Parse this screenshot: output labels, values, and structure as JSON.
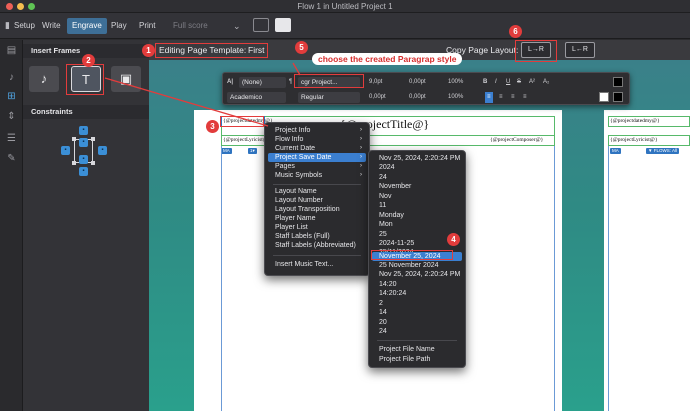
{
  "window": {
    "title": "Flow 1 in Untitled Project 1",
    "traffic_colors": [
      "#ee5f57",
      "#f5bd4f",
      "#5fc454"
    ]
  },
  "toolbar": {
    "modes": [
      "Setup",
      "Write",
      "Engrave",
      "Play",
      "Print"
    ],
    "active_mode": "Engrave",
    "score_selector": "Full score",
    "dropdown_arrow": "⌄"
  },
  "panel": {
    "insert_frames_heading": "Insert Frames",
    "frame_buttons": [
      {
        "icon": "music-frame-icon",
        "glyph": "♪"
      },
      {
        "icon": "text-frame-icon",
        "glyph": "T"
      },
      {
        "icon": "graphics-frame-icon",
        "glyph": "▣"
      }
    ],
    "constraints_heading": "Constraints",
    "lock_glyph": "🔒"
  },
  "workspace": {
    "editing_template_label": "Editing Page Template:",
    "editing_template_value": "First",
    "copy_layout_label": "Copy Page Layout:",
    "copy_forward": "L→R",
    "copy_back": "L←R"
  },
  "para_popover": {
    "style_none": "(None)",
    "para_style": "cgr Project...",
    "font_name": "Academico",
    "font_weight": "Regular",
    "font_size": "9,0pt",
    "spacing1": "0,00pt",
    "spacing2": "0,00pt",
    "spacing3": "0,00pt",
    "percent1": "100%",
    "percent2": "100%",
    "percent3": "100%",
    "percent4": "100%",
    "bold_glyph": "B",
    "italic_glyph": "I",
    "underline_glyph": "U",
    "strike_glyph": "S",
    "super_glyph": "A²",
    "sub_glyph": "A₂"
  },
  "score_page": {
    "title_token": "{@projectTitle@}",
    "date_token": "{@projectdatedmy@}",
    "lyricist_token": "{@projectLyricist@}",
    "composer_token": "{@projectComposer@}",
    "right_date_token": "{@projectdatedmy@}",
    "right_lyricist_token": "{@projectLyricist@}",
    "flows_chip": "▼ FLOWS: All",
    "ma_chip": "MA",
    "one_chip": "1▾"
  },
  "context_menu": {
    "items": [
      {
        "label": "Project Info",
        "submenu": true
      },
      {
        "label": "Flow Info",
        "submenu": true
      },
      {
        "label": "Current Date",
        "submenu": true
      },
      {
        "label": "Project Save Date",
        "submenu": true,
        "highlighted": true
      },
      {
        "label": "Pages",
        "submenu": true
      },
      {
        "label": "Music Symbols",
        "submenu": true
      },
      {
        "label": "Layout Name"
      },
      {
        "label": "Layout Number"
      },
      {
        "label": "Layout Transposition"
      },
      {
        "label": "Player Name"
      },
      {
        "label": "Player List"
      },
      {
        "label": "Staff Labels (Full)"
      },
      {
        "label": "Staff Labels (Abbreviated)"
      },
      {
        "label": "Insert Music Text..."
      }
    ],
    "submenu_arrow": "›"
  },
  "date_submenu": {
    "items": [
      "Nov 25, 2024, 2:20:24 PM",
      "2024",
      "24",
      "November",
      "Nov",
      "11",
      "Monday",
      "Mon",
      "25",
      "2024-11-25",
      "25/11/2024",
      "November 25, 2024",
      "25 November 2024",
      "Nov 25, 2024, 2:20:24 PM",
      "14:20",
      "14:20:24",
      "2",
      "14",
      "20",
      "24",
      "Project File Name",
      "Project File Path"
    ],
    "highlighted_index": 11
  },
  "annotations": {
    "badges": [
      "1",
      "2",
      "3",
      "4",
      "5",
      "6"
    ],
    "callout_5": "choose the created Paragrap style",
    "color": "#e23c3c"
  }
}
